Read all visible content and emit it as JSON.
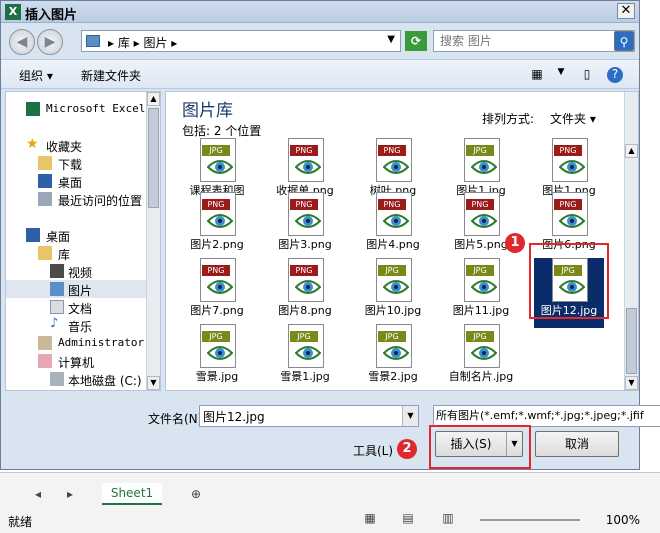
{
  "dialog": {
    "title": "插入图片",
    "close": "✕"
  },
  "address": {
    "crumbs": "▸ 库 ▸ 图片 ▸",
    "search_placeholder": "搜索 图片"
  },
  "toolbar": {
    "organize": "组织 ▾",
    "new_folder": "新建文件夹"
  },
  "nav": [
    {
      "label": "Microsoft Excel",
      "icon": "excel-icon"
    },
    {
      "label": "收藏夹",
      "icon": "star-icon"
    },
    {
      "label": "下载",
      "icon": "download-folder-icon"
    },
    {
      "label": "桌面",
      "icon": "desktop-icon"
    },
    {
      "label": "最近访问的位置",
      "icon": "recent-icon"
    },
    {
      "label": "桌面",
      "icon": "desktop-icon"
    },
    {
      "label": "库",
      "icon": "library-icon"
    },
    {
      "label": "视频",
      "icon": "video-icon"
    },
    {
      "label": "图片",
      "icon": "picture-icon"
    },
    {
      "label": "文档",
      "icon": "document-icon"
    },
    {
      "label": "音乐",
      "icon": "music-icon"
    },
    {
      "label": "Administrator",
      "icon": "user-icon"
    },
    {
      "label": "计算机",
      "icon": "computer-icon"
    },
    {
      "label": "本地磁盘 (C:)",
      "icon": "disk-icon"
    }
  ],
  "library": {
    "title": "图片库",
    "subtitle": "包括: 2 个位置",
    "sort_label": "排列方式:",
    "sort_value": "文件夹 ▾"
  },
  "files": [
    {
      "name": "课程表和图表.jpg",
      "type": "JPG"
    },
    {
      "name": "收据单.png",
      "type": "PNG"
    },
    {
      "name": "树叶.png",
      "type": "PNG"
    },
    {
      "name": "图片1.jpg",
      "type": "JPG"
    },
    {
      "name": "图片1.png",
      "type": "PNG"
    },
    {
      "name": "图片2.png",
      "type": "PNG"
    },
    {
      "name": "图片3.png",
      "type": "PNG"
    },
    {
      "name": "图片4.png",
      "type": "PNG"
    },
    {
      "name": "图片5.png",
      "type": "PNG"
    },
    {
      "name": "图片6.png",
      "type": "PNG"
    },
    {
      "name": "图片7.png",
      "type": "PNG"
    },
    {
      "name": "图片8.png",
      "type": "PNG"
    },
    {
      "name": "图片10.jpg",
      "type": "JPG"
    },
    {
      "name": "图片11.jpg",
      "type": "JPG"
    },
    {
      "name": "图片12.jpg",
      "type": "JPG"
    },
    {
      "name": "雪景.jpg",
      "type": "JPG"
    },
    {
      "name": "雪景1.jpg",
      "type": "JPG"
    },
    {
      "name": "雪景2.jpg",
      "type": "JPG"
    },
    {
      "name": "自制名片.jpg",
      "type": "JPG"
    }
  ],
  "bottom": {
    "filename_label": "文件名(N):",
    "filename_value": "图片12.jpg",
    "filter": "所有图片(*.emf;*.wmf;*.jpg;*.jpeg;*.jfif",
    "tools": "工具(L) ▾",
    "insert": "插入(S)",
    "cancel": "取消"
  },
  "badges": {
    "one": "1",
    "two": "2"
  },
  "excel": {
    "sheet": "Sheet1",
    "status": "就绪",
    "zoom": "100%"
  },
  "colors": {
    "png_tag": "#9b1b1b",
    "jpg_tag": "#7a8a1a",
    "selection": "#0b2c6b",
    "highlight": "#e0282e"
  }
}
